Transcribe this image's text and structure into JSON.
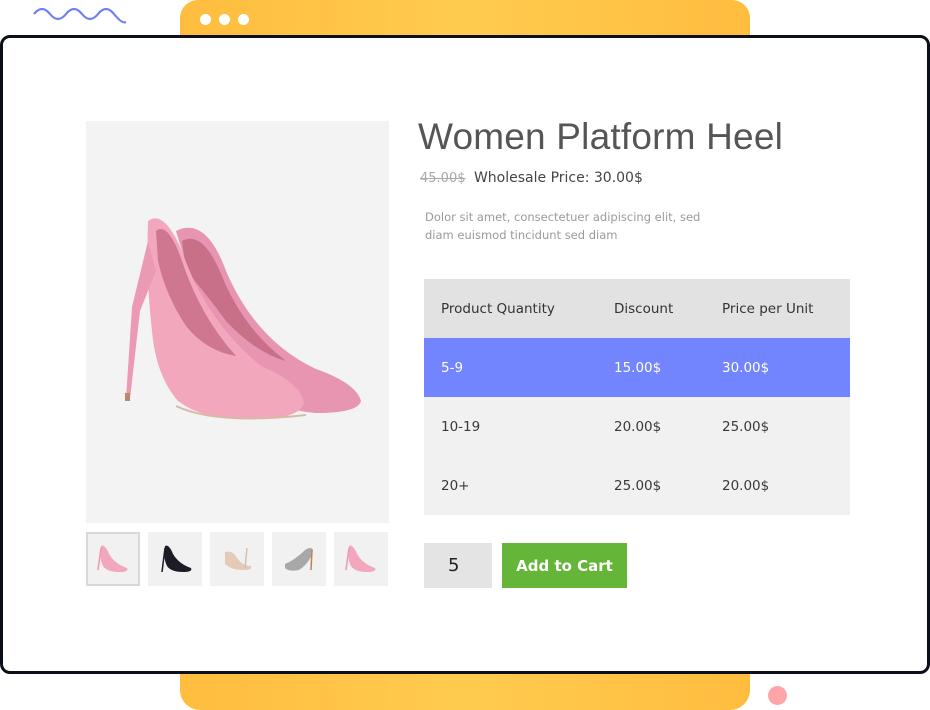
{
  "decor": {
    "accent_blue": "#6f7ff2",
    "accent_yellow": "#ffc246",
    "accent_pink": "#ffa5a7"
  },
  "product": {
    "title": "Women Platform Heel",
    "old_price": "45.00$",
    "wholesale_price": "Wholesale Price: 30.00$",
    "description": "Dolor sit amet, consectetuer adipiscing elit, sed diam euismod tincidunt sed diam",
    "main_image": "pink-heels-image",
    "thumbnails": [
      {
        "name": "pink-heels",
        "color": "#f2a7bd",
        "selected": true
      },
      {
        "name": "black-heels",
        "color": "#1c1c24",
        "selected": false
      },
      {
        "name": "nude-heels",
        "color": "#e3cbb8",
        "selected": false
      },
      {
        "name": "silver-heels",
        "color": "#a8a8a8",
        "selected": false
      },
      {
        "name": "pink-heels",
        "color": "#f2a7bd",
        "selected": false
      }
    ]
  },
  "table": {
    "headers": [
      "Product Quantity",
      "Discount",
      "Price per Unit"
    ],
    "rows": [
      {
        "quantity": "5-9",
        "discount": "15.00$",
        "price": "30.00$",
        "active": true
      },
      {
        "quantity": "10-19",
        "discount": "20.00$",
        "price": "25.00$",
        "active": false
      },
      {
        "quantity": "20+",
        "discount": "25.00$",
        "price": "20.00$",
        "active": false
      }
    ],
    "active_color": "#7285ff"
  },
  "cart": {
    "quantity": "5",
    "add_label": "Add to Cart",
    "button_color": "#64b538"
  }
}
